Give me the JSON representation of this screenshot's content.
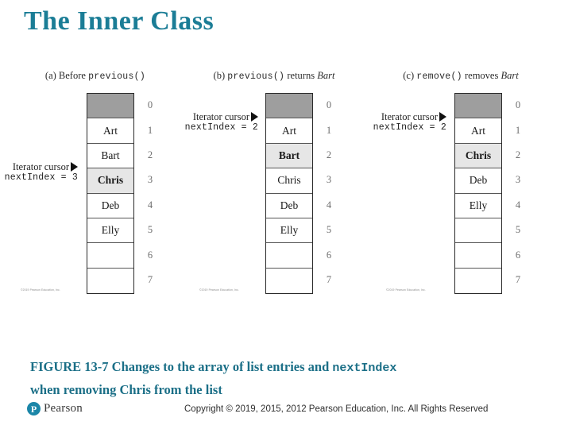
{
  "slide": {
    "title": "The Inner Class"
  },
  "figure": {
    "panels": [
      {
        "id": "a",
        "caption_prefix": "(a) Before ",
        "caption_code": "previous()",
        "caption_suffix": "",
        "caption_italic": "",
        "cursor_label": "Iterator cursor",
        "cursor_value": "nextIndex = 3",
        "cursor_row": 3,
        "cells": [
          {
            "index": "0",
            "value": "",
            "state": "shaded"
          },
          {
            "index": "1",
            "value": "Art",
            "state": "normal"
          },
          {
            "index": "2",
            "value": "Bart",
            "state": "normal"
          },
          {
            "index": "3",
            "value": "Chris",
            "state": "current"
          },
          {
            "index": "4",
            "value": "Deb",
            "state": "normal"
          },
          {
            "index": "5",
            "value": "Elly",
            "state": "normal"
          },
          {
            "index": "6",
            "value": "",
            "state": "normal"
          },
          {
            "index": "7",
            "value": "",
            "state": "normal"
          }
        ],
        "attribution": "©2019 Pearson Education, Inc."
      },
      {
        "id": "b",
        "caption_prefix": "(b) ",
        "caption_code": "previous()",
        "caption_suffix": " returns ",
        "caption_italic": "Bart",
        "cursor_label": "Iterator cursor",
        "cursor_value": "nextIndex = 2",
        "cursor_row": 2,
        "cells": [
          {
            "index": "0",
            "value": "",
            "state": "shaded"
          },
          {
            "index": "1",
            "value": "Art",
            "state": "normal"
          },
          {
            "index": "2",
            "value": "Bart",
            "state": "current"
          },
          {
            "index": "3",
            "value": "Chris",
            "state": "normal"
          },
          {
            "index": "4",
            "value": "Deb",
            "state": "normal"
          },
          {
            "index": "5",
            "value": "Elly",
            "state": "normal"
          },
          {
            "index": "6",
            "value": "",
            "state": "normal"
          },
          {
            "index": "7",
            "value": "",
            "state": "normal"
          }
        ],
        "attribution": "©2019 Pearson Education, Inc."
      },
      {
        "id": "c",
        "caption_prefix": "(c) ",
        "caption_code": "remove()",
        "caption_suffix": " removes ",
        "caption_italic": "Bart",
        "cursor_label": "Iterator cursor",
        "cursor_value": "nextIndex = 2",
        "cursor_row": 2,
        "cells": [
          {
            "index": "0",
            "value": "",
            "state": "shaded"
          },
          {
            "index": "1",
            "value": "Art",
            "state": "normal"
          },
          {
            "index": "2",
            "value": "Chris",
            "state": "current"
          },
          {
            "index": "3",
            "value": "Deb",
            "state": "normal"
          },
          {
            "index": "4",
            "value": "Elly",
            "state": "normal"
          },
          {
            "index": "5",
            "value": "",
            "state": "normal"
          },
          {
            "index": "6",
            "value": "",
            "state": "normal"
          },
          {
            "index": "7",
            "value": "",
            "state": "normal"
          }
        ],
        "attribution": "©2019 Pearson Education, Inc."
      }
    ],
    "caption_part1": "FIGURE 13-7 Changes to the array of list entries and ",
    "caption_code": "nextIndex",
    "caption_part2": "when removing Chris from the list"
  },
  "footer": {
    "logo_letter": "P",
    "logo_word": "Pearson",
    "copyright": "Copyright © 2019, 2015, 2012 Pearson Education, Inc. All Rights Reserved"
  },
  "colors": {
    "title_teal": "#1b7d96",
    "caption_teal": "#1b6f87",
    "cell_shaded": "#9e9e9e",
    "cell_current": "#e6e6e6",
    "logo_teal": "#1b86a8"
  }
}
